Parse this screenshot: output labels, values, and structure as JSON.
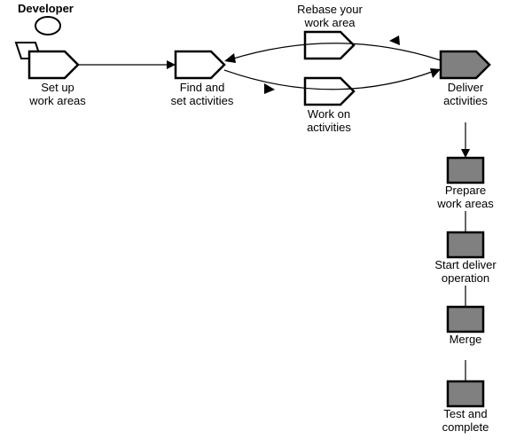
{
  "role": "Developer",
  "nodes": {
    "setup": {
      "label_l1": "Set up",
      "label_l2": "work areas"
    },
    "find": {
      "label_l1": "Find and",
      "label_l2": "set activities"
    },
    "rebase": {
      "label_l1": "Rebase your",
      "label_l2": "work area"
    },
    "work": {
      "label_l1": "Work on",
      "label_l2": "activities"
    },
    "deliver": {
      "label_l1": "Deliver",
      "label_l2": "activities"
    },
    "prepare": {
      "label_l1": "Prepare",
      "label_l2": "work areas"
    },
    "start": {
      "label_l1": "Start deliver",
      "label_l2": "operation"
    },
    "merge": {
      "label_l1": "Merge",
      "label_l2": ""
    },
    "test": {
      "label_l1": "Test and",
      "label_l2": "complete"
    }
  }
}
